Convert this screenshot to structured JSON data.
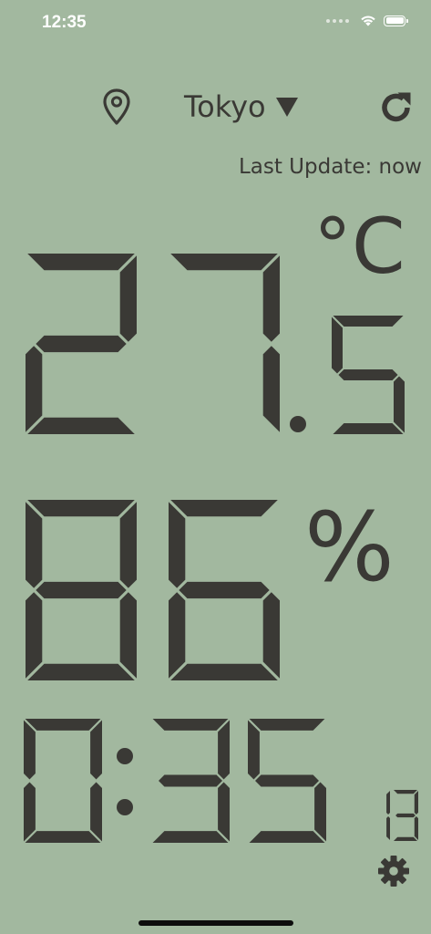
{
  "status_bar": {
    "time": "12:35"
  },
  "header": {
    "city": "Tokyo"
  },
  "last_update": "Last Update: now",
  "temperature": {
    "integer": "27",
    "decimal": "5",
    "unit": "°C"
  },
  "humidity": {
    "value": "86",
    "unit": "%"
  },
  "clock": {
    "hours": "0",
    "minutes": "35",
    "seconds": "13"
  },
  "icons": {
    "location": "location-pin-icon",
    "dropdown": "triangle-down-icon",
    "refresh": "refresh-icon",
    "settings": "gear-icon"
  },
  "colors": {
    "background": "#a2b89f",
    "lcd_segment": "#3a3935",
    "status_text": "#ffffff"
  }
}
